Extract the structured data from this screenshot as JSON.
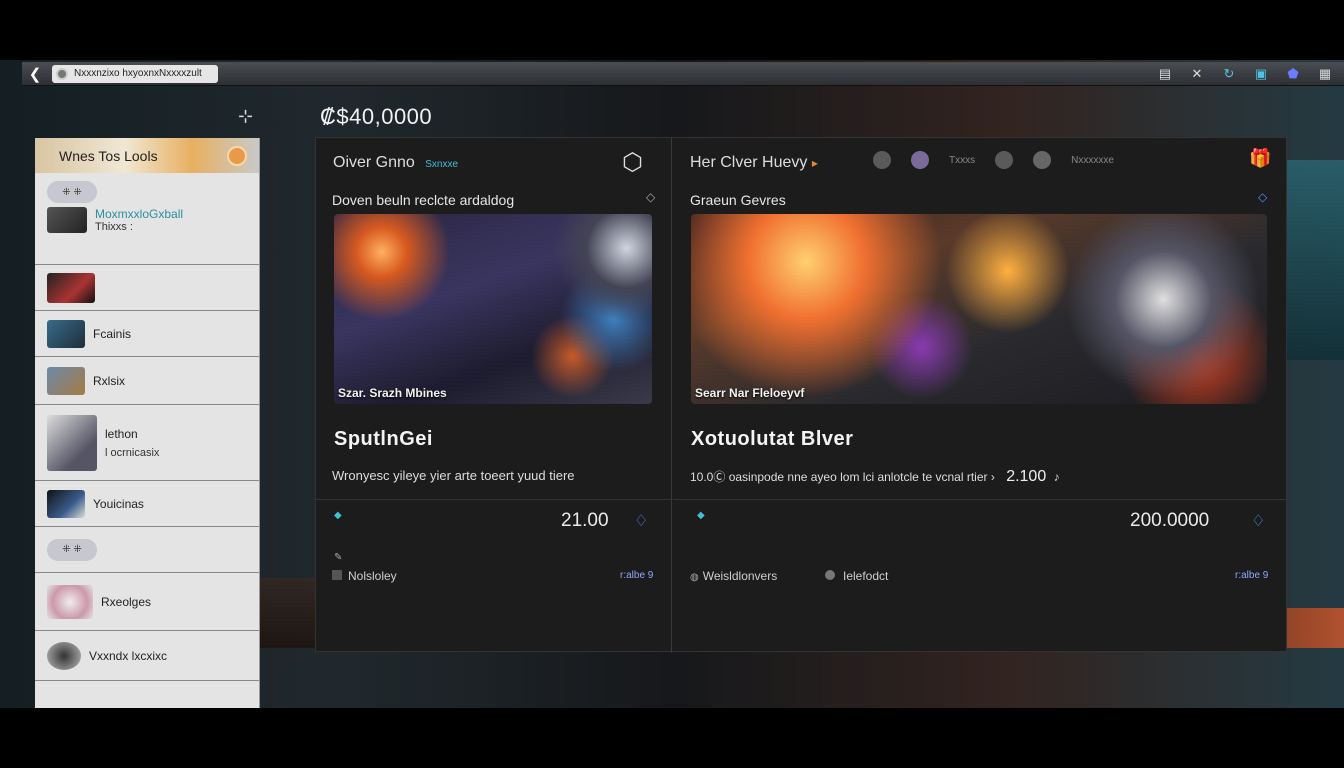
{
  "browser": {
    "url": "Nxxxnzixo hxyoxnxNxxxxzult"
  },
  "balance": {
    "amount": "₡$40,0000"
  },
  "sidebar": {
    "header": "Wnes Tos Lools",
    "items": [
      {
        "label": "MoxmxxloGxball",
        "sub": "Thixxs :"
      },
      {
        "label": "",
        "sub": ""
      },
      {
        "label": "Fcainis",
        "sub": ""
      },
      {
        "label": "Rxlsix",
        "sub": ""
      },
      {
        "label": "lethon",
        "sub": "l ocrnicasix"
      },
      {
        "label": "Youicinas",
        "sub": ""
      },
      {
        "label": "",
        "sub": ""
      },
      {
        "label": "Rxeolges",
        "sub": ""
      },
      {
        "label": "Vxxndx lxcxixc",
        "sub": ""
      }
    ]
  },
  "left_panel": {
    "title": "Oiver Gnno",
    "tag": "Sxnxxe",
    "subtitle": "Doven beuln reclcte ardaldog",
    "hero_caption": "Szar. Srazh Mbines",
    "game_title": "SputlnGei",
    "description": "Wronyesc yileye yier arte toeert yuud tiere",
    "price": "21.00",
    "footer_label": "Nolsloley",
    "footer_link": "r:albe 9"
  },
  "right_panel": {
    "title": "Her Clver Huevy",
    "header_tags": [
      "Txxxs",
      "Nxxxxxxe"
    ],
    "subtitle": "Graeun Gevres",
    "hero_caption": "Searr Nar Fleloeyvf",
    "game_title": "Xotuolutat Blver",
    "description": "10.0Ⓒ oasinpode nne ayeo lom lci anlotcle te vcnal rtier ›",
    "description_value": "2.100",
    "price": "200.0000",
    "footer_label_1": "Weisldlonvers",
    "footer_label_2": "Ielefodct",
    "footer_link": "r:albe 9"
  },
  "colors": {
    "accent_blue": "#5b8cff",
    "accent_teal": "#3ec1d3",
    "panel_bg": "#1c1c1d"
  }
}
